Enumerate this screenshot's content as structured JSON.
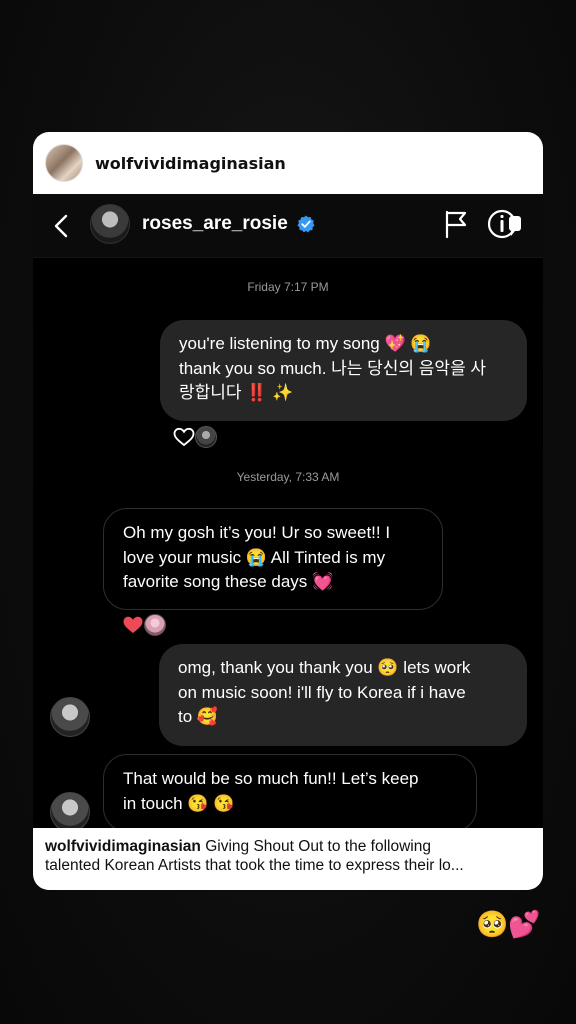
{
  "post": {
    "username": "wolfvividimaginasian"
  },
  "dm": {
    "contact": "roses_are_rosie",
    "verified": true
  },
  "messages": {
    "ts1": "Friday 7:17 PM",
    "ts2": "Yesterday, 7:33 AM",
    "m1": {
      "line1": "you're listening to my song 💖 😭",
      "line2": "thank you so much. 나는 당신의 음악을 사",
      "line3": "랑합니다 ‼️ ✨"
    },
    "m2": {
      "line1": "Oh my gosh it’s you! Ur so sweet!! I",
      "line2": "love your music 😭 All Tinted is my",
      "line3": "favorite song these days 💓"
    },
    "m3": {
      "line1": "omg, thank you thank you 🥺 lets work",
      "line2": "on music soon! i'll fly to Korea if i have",
      "line3": "to 🥰"
    },
    "m4": {
      "line1": "That would be so much fun!! Let’s keep",
      "line2": "in touch 😘 😘"
    }
  },
  "caption": {
    "username": "wolfvividimaginasian",
    "text_line1": " Giving Shout Out to the following",
    "text_line2": "talented Korean Artists that took the time to express their lo..."
  },
  "sticker": "🥺💕",
  "colors": {
    "verified_blue": "#3897f0",
    "heart_red": "#ed4956",
    "outgoing_bubble": "#262626"
  }
}
